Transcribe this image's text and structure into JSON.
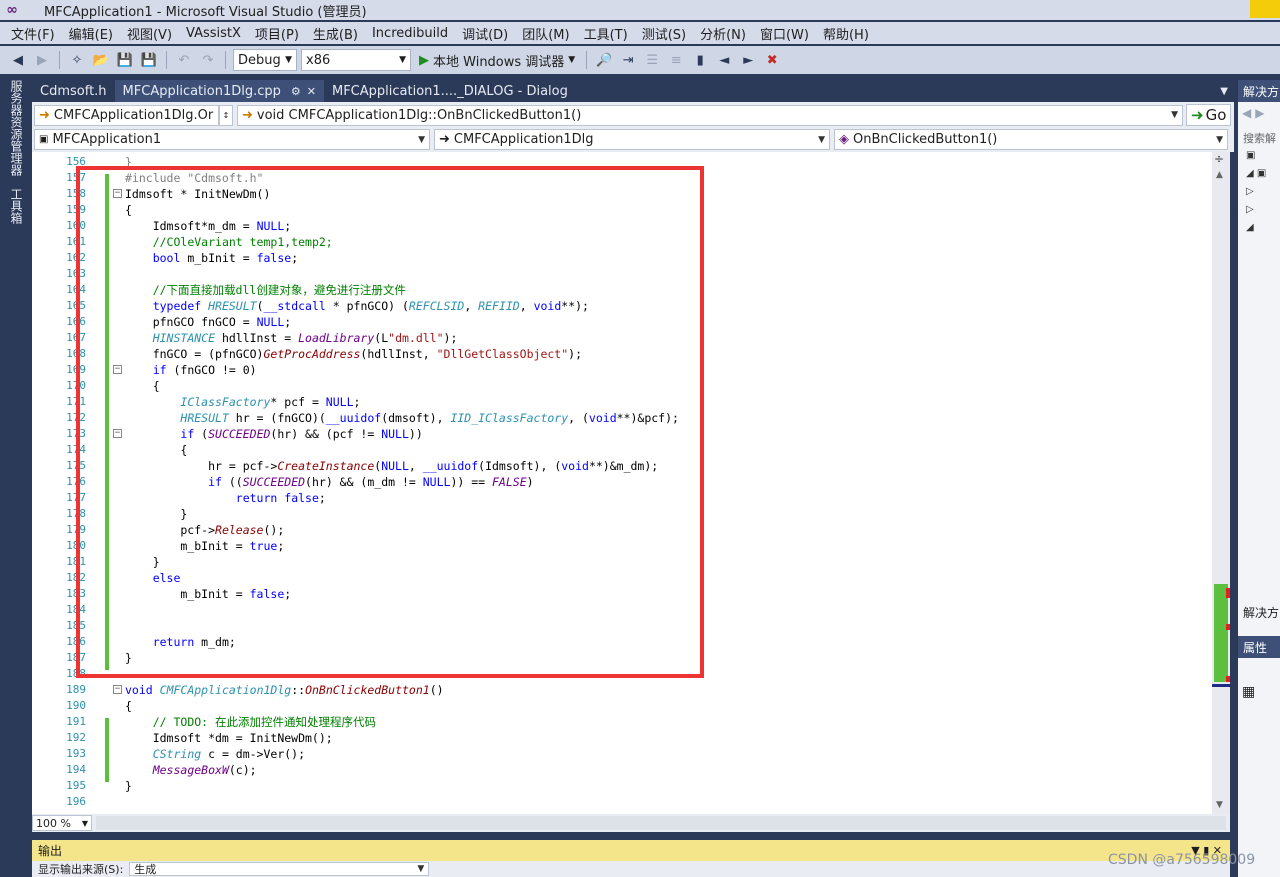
{
  "window": {
    "title": "MFCApplication1 - Microsoft Visual Studio (管理员)"
  },
  "menu": [
    "文件(F)",
    "编辑(E)",
    "视图(V)",
    "VAssistX",
    "项目(P)",
    "生成(B)",
    "Incredibuild",
    "调试(D)",
    "团队(M)",
    "工具(T)",
    "测试(S)",
    "分析(N)",
    "窗口(W)",
    "帮助(H)"
  ],
  "toolbar": {
    "config": "Debug",
    "platform": "x86",
    "run_label": "本地 Windows 调试器"
  },
  "left_strip": {
    "tab1": "服务器资源管理器",
    "tab2": "工具箱"
  },
  "tabs": [
    {
      "label": "Cdmsoft.h"
    },
    {
      "label": "MFCApplication1Dlg.cpp"
    },
    {
      "label": "MFCApplication1...._DIALOG - Dialog"
    }
  ],
  "nav": {
    "class_combo": "CMFCApplication1Dlg.Or",
    "func_combo": "void CMFCApplication1Dlg::OnBnClickedButton1()",
    "go": "Go",
    "project_combo": "MFCApplication1",
    "scope_combo": "CMFCApplication1Dlg",
    "member_combo": "OnBnClickedButton1()"
  },
  "code_lines": [
    {
      "n": "156",
      "t": "<span class=\"pp\">}</span>"
    },
    {
      "n": "157",
      "t": "<span class=\"pp\">#include \"Cdmsoft.h\"</span>"
    },
    {
      "n": "158",
      "t": "Idmsoft * InitNewDm()",
      "fold": true
    },
    {
      "n": "159",
      "t": "{"
    },
    {
      "n": "160",
      "t": "    Idmsoft*m_dm = <span class=\"kw\">NULL</span>;"
    },
    {
      "n": "161",
      "t": "    <span class=\"cm\">//COleVariant temp1,temp2;</span>"
    },
    {
      "n": "162",
      "t": "    <span class=\"kw\">bool</span> m_bInit = <span class=\"kw\">false</span>;"
    },
    {
      "n": "163",
      "t": ""
    },
    {
      "n": "164",
      "t": "    <span class=\"cm\">//下面直接加载dll创建对象，避免进行注册文件</span>"
    },
    {
      "n": "165",
      "t": "    <span class=\"kw\">typedef</span> <span class=\"ty\">HRESULT</span>(<span class=\"kw\">__stdcall</span> * pfnGCO) (<span class=\"ty\">REFCLSID</span>, <span class=\"ty\">REFIID</span>, <span class=\"kw\">void</span>**);"
    },
    {
      "n": "166",
      "t": "    pfnGCO fnGCO = <span class=\"kw\">NULL</span>;"
    },
    {
      "n": "167",
      "t": "    <span class=\"ty\">HINSTANCE</span> hdllInst = <span class=\"mc\">LoadLibrary</span>(L<span class=\"st\">\"dm.dll\"</span>);"
    },
    {
      "n": "168",
      "t": "    fnGCO = (pfnGCO)<span class=\"fn\">GetProcAddress</span>(hdllInst, <span class=\"st\">\"DllGetClassObject\"</span>);"
    },
    {
      "n": "169",
      "t": "    <span class=\"kw\">if</span> (fnGCO != 0)",
      "fold": true
    },
    {
      "n": "170",
      "t": "    {"
    },
    {
      "n": "171",
      "t": "        <span class=\"ty\">IClassFactory</span>* pcf = <span class=\"kw\">NULL</span>;"
    },
    {
      "n": "172",
      "t": "        <span class=\"ty\">HRESULT</span> hr = (fnGCO)(<span class=\"kw\">__uuidof</span>(dmsoft), <span class=\"ty\">IID_IClassFactory</span>, (<span class=\"kw\">void</span>**)&amp;pcf);"
    },
    {
      "n": "173",
      "t": "        <span class=\"kw\">if</span> (<span class=\"mc\">SUCCEEDED</span>(hr) &amp;&amp; (pcf != <span class=\"kw\">NULL</span>))",
      "fold": true
    },
    {
      "n": "174",
      "t": "        {"
    },
    {
      "n": "175",
      "t": "            hr = pcf-&gt;<span class=\"fn\">CreateInstance</span>(<span class=\"kw\">NULL</span>, <span class=\"kw\">__uuidof</span>(Idmsoft), (<span class=\"kw\">void</span>**)&amp;m_dm);"
    },
    {
      "n": "176",
      "t": "            <span class=\"kw\">if</span> ((<span class=\"mc\">SUCCEEDED</span>(hr) &amp;&amp; (m_dm != <span class=\"kw\">NULL</span>)) == <span class=\"mc\">FALSE</span>)"
    },
    {
      "n": "177",
      "t": "                <span class=\"kw\">return</span> <span class=\"kw\">false</span>;"
    },
    {
      "n": "178",
      "t": "        }"
    },
    {
      "n": "179",
      "t": "        pcf-&gt;<span class=\"fn\">Release</span>();"
    },
    {
      "n": "180",
      "t": "        m_bInit = <span class=\"kw\">true</span>;"
    },
    {
      "n": "181",
      "t": "    }"
    },
    {
      "n": "182",
      "t": "    <span class=\"kw\">else</span>"
    },
    {
      "n": "183",
      "t": "        m_bInit = <span class=\"kw\">false</span>;"
    },
    {
      "n": "184",
      "t": ""
    },
    {
      "n": "185",
      "t": ""
    },
    {
      "n": "186",
      "t": "    <span class=\"kw\">return</span> m_dm;"
    },
    {
      "n": "187",
      "t": "}"
    },
    {
      "n": "188",
      "t": ""
    },
    {
      "n": "189",
      "t": "<span class=\"kw\">void</span> <span class=\"ty\">CMFCApplication1Dlg</span>::<span class=\"fn\">OnBnClickedButton1</span>()",
      "fold": true
    },
    {
      "n": "190",
      "t": "{"
    },
    {
      "n": "191",
      "t": "    <span class=\"cm\">// TODO: 在此添加控件通知处理程序代码</span>"
    },
    {
      "n": "192",
      "t": "    Idmsoft *dm = InitNewDm();"
    },
    {
      "n": "193",
      "t": "    <span class=\"ty\">CString</span> c = dm-&gt;Ver();"
    },
    {
      "n": "194",
      "t": "    <span class=\"mc\">MessageBoxW</span>(c);"
    },
    {
      "n": "195",
      "t": "}"
    },
    {
      "n": "196",
      "t": ""
    }
  ],
  "zoom": "100 %",
  "output": {
    "title": "输出",
    "source_label": "显示输出来源(S):",
    "source_value": "生成"
  },
  "right_panel": {
    "title": "解决方",
    "search": "搜索解",
    "title2": "解决方",
    "props": "属性"
  },
  "watermark": "CSDN @a756598009"
}
